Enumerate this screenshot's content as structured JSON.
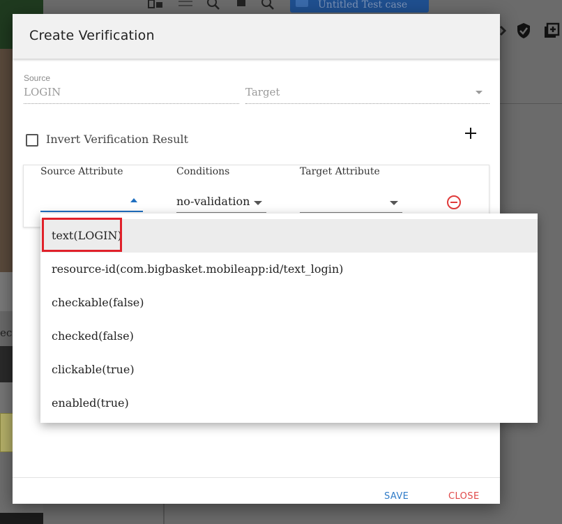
{
  "background": {
    "tab_label": "Untitled Test case",
    "left_strip_text": "eci"
  },
  "dialog": {
    "title": "Create Verification",
    "source": {
      "label": "Source",
      "value": "LOGIN"
    },
    "target": {
      "placeholder": "Target"
    },
    "invert_checkbox": {
      "label": "Invert Verification Result",
      "checked": false
    },
    "attributes": {
      "headers": {
        "source_attribute": "Source Attribute",
        "conditions": "Conditions",
        "target_attribute": "Target Attribute"
      },
      "row": {
        "source_attribute_value": "",
        "condition_value": "no-validation",
        "target_attribute_value": ""
      }
    },
    "buttons": {
      "save": "SAVE",
      "close": "CLOSE"
    }
  },
  "dropdown": {
    "items": [
      "text(LOGIN)",
      "resource-id(com.bigbasket.mobileapp:id/text_login)",
      "checkable(false)",
      "checked(false)",
      "clickable(true)",
      "enabled(true)"
    ],
    "selected_index": 0
  },
  "colors": {
    "primary": "#1f6fc0",
    "save": "#2f7bc7",
    "close": "#e04848",
    "highlight": "#e0212a",
    "remove_icon": "#e03a3a"
  },
  "icons": {
    "add": "plus-icon",
    "remove": "minus-circle-icon",
    "shield": "shield-check-icon",
    "add_box": "add-box-icon"
  }
}
